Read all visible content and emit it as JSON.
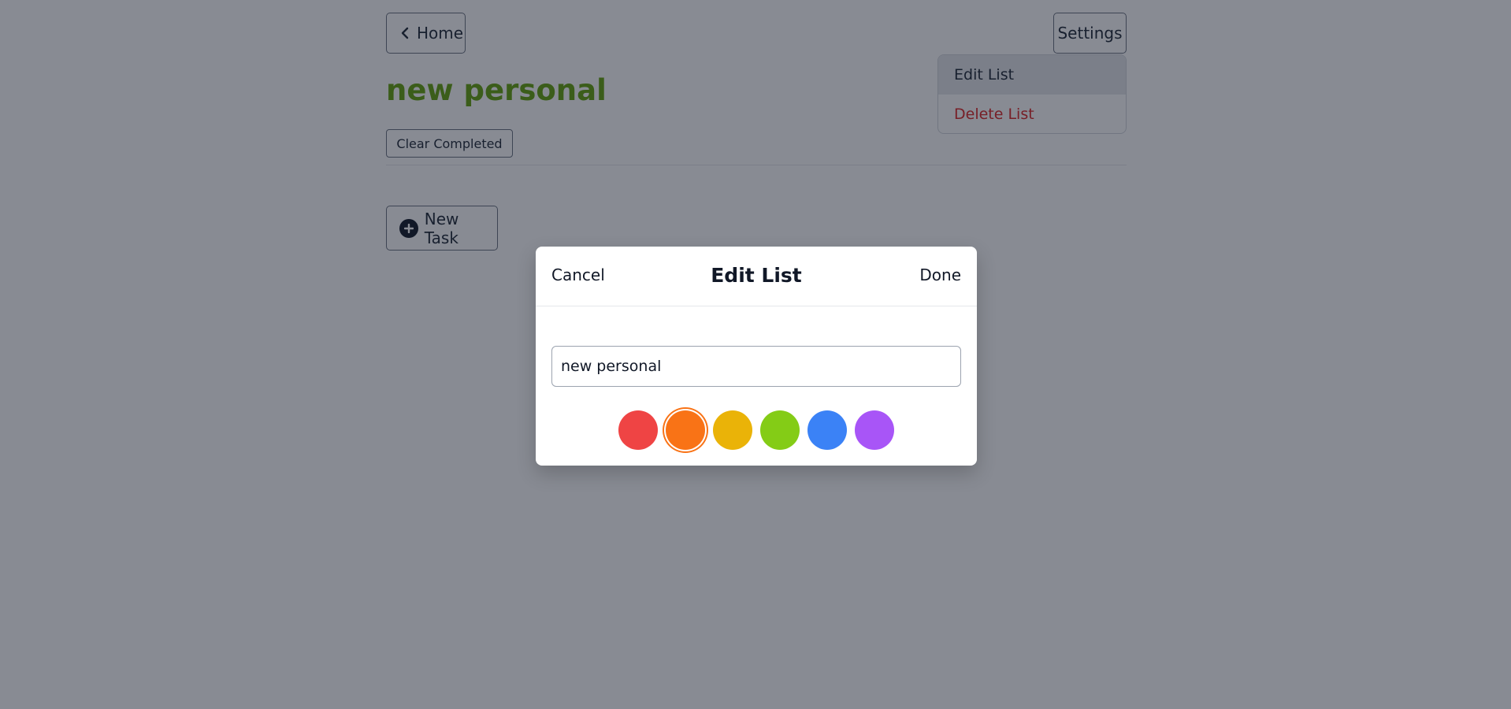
{
  "header": {
    "home_label": "Home",
    "settings_label": "Settings"
  },
  "settings_menu": {
    "items": [
      {
        "label": "Edit List"
      },
      {
        "label": "Delete List"
      }
    ]
  },
  "list": {
    "title": "new personal",
    "title_color": "#65a30d",
    "clear_completed_label": "Clear Completed",
    "new_task_label": "New Task"
  },
  "modal": {
    "cancel_label": "Cancel",
    "title": "Edit List",
    "done_label": "Done",
    "name_value": "new personal",
    "colors": [
      {
        "name": "red",
        "hex": "#ef4444",
        "selected": false
      },
      {
        "name": "orange",
        "hex": "#f97316",
        "selected": true
      },
      {
        "name": "yellow",
        "hex": "#eab308",
        "selected": false
      },
      {
        "name": "green",
        "hex": "#84cc16",
        "selected": false
      },
      {
        "name": "blue",
        "hex": "#3b82f6",
        "selected": false
      },
      {
        "name": "purple",
        "hex": "#a855f7",
        "selected": false
      }
    ]
  }
}
